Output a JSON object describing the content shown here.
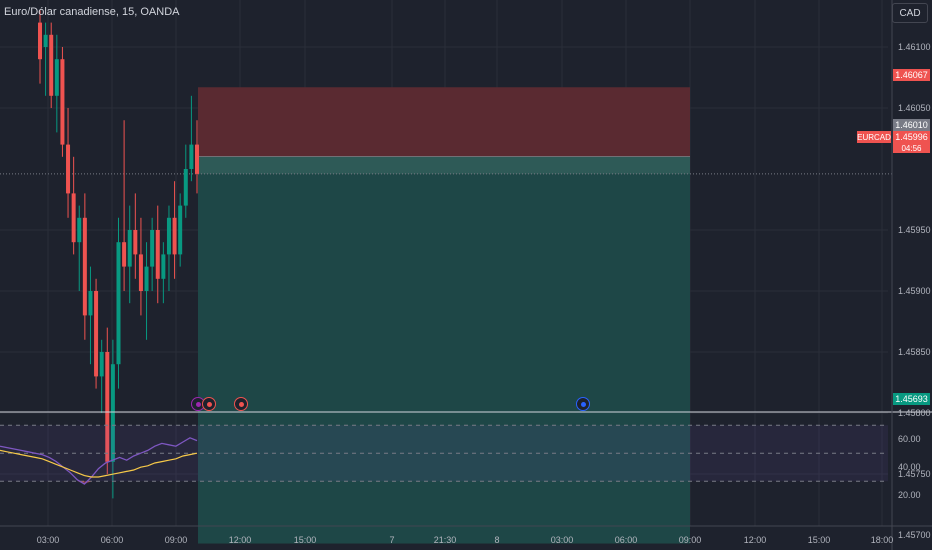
{
  "header": {
    "symbol_title": "Euro/Dólar canadiense, 15, OANDA"
  },
  "currency_button": "CAD",
  "price_axis": {
    "ticks": [
      "1.46100",
      "1.46050",
      "1.45950",
      "1.45900",
      "1.45850",
      "1.45800",
      "1.45750",
      "1.45700"
    ]
  },
  "price_tags": {
    "stop": "1.46067",
    "entry": "1.46010",
    "last": "1.45996",
    "target": "1.45693",
    "symbol": "EURCAD",
    "countdown": "04:56"
  },
  "rsi_axis": {
    "ticks": [
      "60.00",
      "40.00",
      "20.00"
    ]
  },
  "time_axis": {
    "ticks": [
      "03:00",
      "06:00",
      "09:00",
      "12:00",
      "15:00",
      "7",
      "21:30",
      "8",
      "03:00",
      "06:00",
      "09:00",
      "12:00",
      "15:00",
      "18:00"
    ]
  },
  "events": [
    {
      "name": "lightning-event-icon",
      "color": "#9c27b0"
    },
    {
      "name": "canada-flag-event-icon",
      "color": "#ef5350"
    },
    {
      "name": "canada-flag-event-icon",
      "color": "#ef5350"
    },
    {
      "name": "eu-flag-event-icon",
      "color": "#2962ff"
    }
  ],
  "colors": {
    "up": "#089981",
    "down": "#ef5350",
    "rsi": "#7e57c2",
    "rsi_ma": "#f7c948",
    "stop_zone": "#5a2a31",
    "target_zone": "#1e4747"
  },
  "chart_data": {
    "type": "candlestick",
    "ylim": [
      1.45685,
      1.46125
    ],
    "candles": [
      [
        1.4612,
        1.4613,
        1.4607,
        1.4609
      ],
      [
        1.461,
        1.4612,
        1.4606,
        1.4611
      ],
      [
        1.4611,
        1.4612,
        1.4605,
        1.4606
      ],
      [
        1.4606,
        1.4611,
        1.4603,
        1.4609
      ],
      [
        1.4609,
        1.461,
        1.4601,
        1.4602
      ],
      [
        1.4602,
        1.4605,
        1.4596,
        1.4598
      ],
      [
        1.4598,
        1.4601,
        1.4593,
        1.4594
      ],
      [
        1.4594,
        1.4597,
        1.459,
        1.4596
      ],
      [
        1.4596,
        1.4598,
        1.4586,
        1.4588
      ],
      [
        1.4588,
        1.4592,
        1.4584,
        1.459
      ],
      [
        1.459,
        1.4591,
        1.4582,
        1.4583
      ],
      [
        1.4583,
        1.4586,
        1.458,
        1.4585
      ],
      [
        1.4585,
        1.4587,
        1.4575,
        1.4576
      ],
      [
        1.4576,
        1.4586,
        1.4573,
        1.4584
      ],
      [
        1.4584,
        1.4596,
        1.4582,
        1.4594
      ],
      [
        1.4594,
        1.4604,
        1.459,
        1.4592
      ],
      [
        1.4592,
        1.4597,
        1.4589,
        1.4595
      ],
      [
        1.4595,
        1.4598,
        1.4591,
        1.4593
      ],
      [
        1.4593,
        1.4596,
        1.4588,
        1.459
      ],
      [
        1.459,
        1.4594,
        1.4586,
        1.4592
      ],
      [
        1.4592,
        1.4596,
        1.459,
        1.4595
      ],
      [
        1.4595,
        1.4597,
        1.4589,
        1.4591
      ],
      [
        1.4591,
        1.4594,
        1.4589,
        1.4593
      ],
      [
        1.4593,
        1.4597,
        1.459,
        1.4596
      ],
      [
        1.4596,
        1.4599,
        1.4591,
        1.4593
      ],
      [
        1.4593,
        1.4598,
        1.4592,
        1.4597
      ],
      [
        1.4597,
        1.4602,
        1.4596,
        1.46
      ],
      [
        1.46,
        1.4606,
        1.4599,
        1.4602
      ],
      [
        1.4602,
        1.4604,
        1.4598,
        1.45996
      ]
    ],
    "position": {
      "stop": 1.46067,
      "entry": 1.4601,
      "target": 1.45693
    },
    "rsi": [
      55,
      54,
      53,
      52,
      51,
      50,
      49,
      47,
      44,
      40,
      36,
      31,
      28,
      33,
      39,
      43,
      45,
      47,
      45,
      48,
      50,
      52,
      55,
      57,
      56,
      55,
      58,
      61,
      59
    ],
    "rsi_ma": [
      52,
      51,
      50,
      49,
      48,
      47,
      46,
      44,
      42,
      40,
      38,
      36,
      34,
      33,
      33,
      34,
      35,
      36,
      37,
      38,
      40,
      41,
      43,
      44,
      45,
      46,
      48,
      49,
      50
    ],
    "rsi_levels": [
      70,
      50,
      30
    ]
  }
}
